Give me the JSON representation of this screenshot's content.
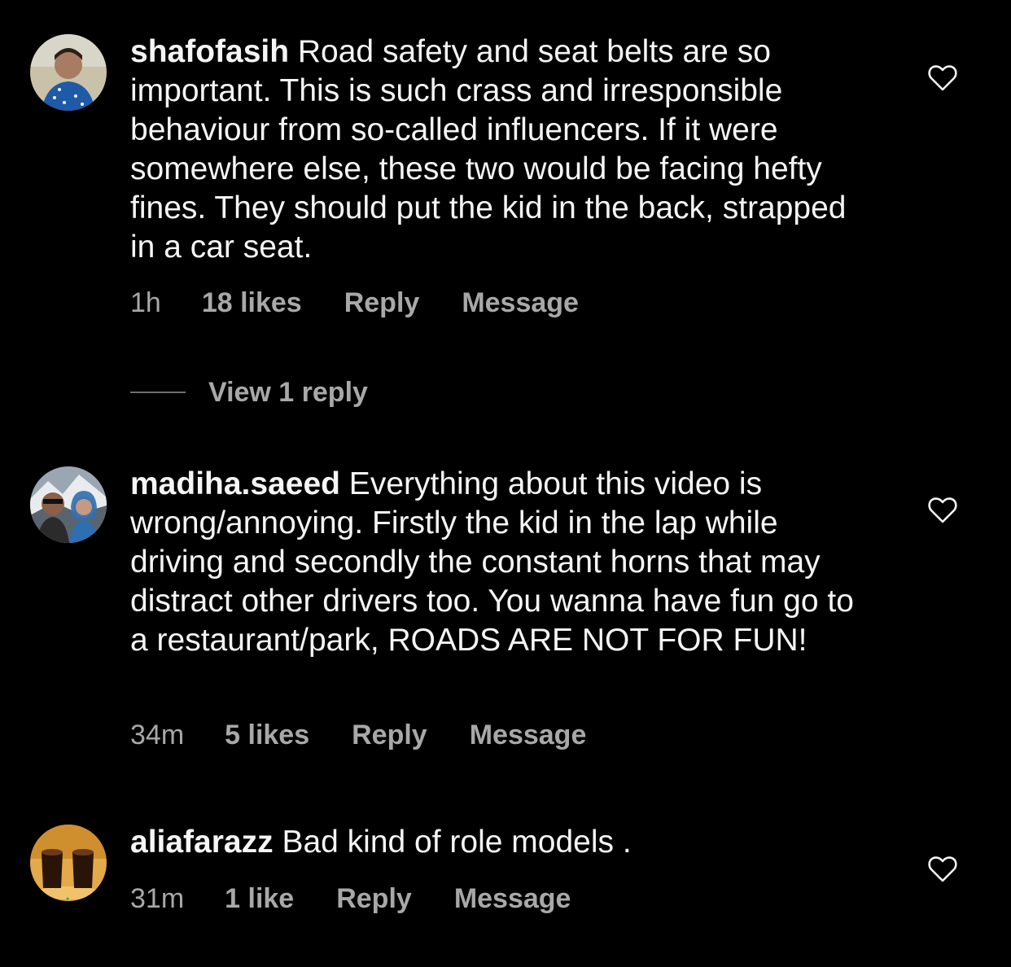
{
  "comments": [
    {
      "username": "shafofasih",
      "text": " Road safety and seat belts are so important. This is such crass and irresponsible behaviour from so-called influencers. If it were somewhere else, these two would be facing hefty fines. They should put the kid in the back, strapped in a car seat.",
      "time": "1h",
      "likes": "18 likes",
      "reply": "Reply",
      "message": "Message",
      "avatar_icon": "avatar-photo-person",
      "like_icon": "heart-outline-icon"
    },
    {
      "username": "madiha.saeed",
      "text": " Everything about this video is wrong/annoying. Firstly the kid in the lap while driving and secondly the constant horns that may distract other drivers too. You wanna have fun go to a restaurant/park, ROADS ARE NOT FOR FUN!",
      "time": "34m",
      "likes": "5 likes",
      "reply": "Reply",
      "message": "Message",
      "avatar_icon": "avatar-photo-couple",
      "like_icon": "heart-outline-icon"
    },
    {
      "username": "aliafarazz",
      "text": " Bad kind of role models .",
      "time": "31m",
      "likes": "1 like",
      "reply": "Reply",
      "message": "Message",
      "avatar_icon": "avatar-photo-cups",
      "like_icon": "heart-outline-icon"
    }
  ],
  "view_replies": {
    "label": "View 1 reply"
  },
  "colors": {
    "background": "#000000",
    "text_primary": "#f5f5f5",
    "text_secondary": "#a8a8a8",
    "divider": "#6e6e6e"
  }
}
